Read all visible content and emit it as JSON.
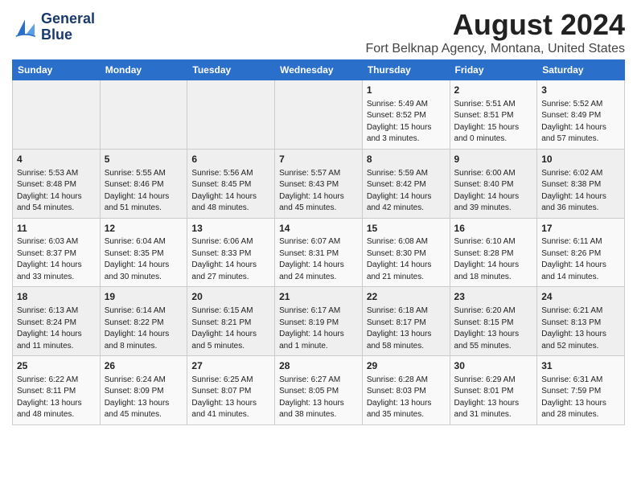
{
  "header": {
    "logo_line1": "General",
    "logo_line2": "Blue",
    "main_title": "August 2024",
    "subtitle": "Fort Belknap Agency, Montana, United States"
  },
  "weekdays": [
    "Sunday",
    "Monday",
    "Tuesday",
    "Wednesday",
    "Thursday",
    "Friday",
    "Saturday"
  ],
  "weeks": [
    [
      {
        "day": "",
        "info": ""
      },
      {
        "day": "",
        "info": ""
      },
      {
        "day": "",
        "info": ""
      },
      {
        "day": "",
        "info": ""
      },
      {
        "day": "1",
        "info": "Sunrise: 5:49 AM\nSunset: 8:52 PM\nDaylight: 15 hours\nand 3 minutes."
      },
      {
        "day": "2",
        "info": "Sunrise: 5:51 AM\nSunset: 8:51 PM\nDaylight: 15 hours\nand 0 minutes."
      },
      {
        "day": "3",
        "info": "Sunrise: 5:52 AM\nSunset: 8:49 PM\nDaylight: 14 hours\nand 57 minutes."
      }
    ],
    [
      {
        "day": "4",
        "info": "Sunrise: 5:53 AM\nSunset: 8:48 PM\nDaylight: 14 hours\nand 54 minutes."
      },
      {
        "day": "5",
        "info": "Sunrise: 5:55 AM\nSunset: 8:46 PM\nDaylight: 14 hours\nand 51 minutes."
      },
      {
        "day": "6",
        "info": "Sunrise: 5:56 AM\nSunset: 8:45 PM\nDaylight: 14 hours\nand 48 minutes."
      },
      {
        "day": "7",
        "info": "Sunrise: 5:57 AM\nSunset: 8:43 PM\nDaylight: 14 hours\nand 45 minutes."
      },
      {
        "day": "8",
        "info": "Sunrise: 5:59 AM\nSunset: 8:42 PM\nDaylight: 14 hours\nand 42 minutes."
      },
      {
        "day": "9",
        "info": "Sunrise: 6:00 AM\nSunset: 8:40 PM\nDaylight: 14 hours\nand 39 minutes."
      },
      {
        "day": "10",
        "info": "Sunrise: 6:02 AM\nSunset: 8:38 PM\nDaylight: 14 hours\nand 36 minutes."
      }
    ],
    [
      {
        "day": "11",
        "info": "Sunrise: 6:03 AM\nSunset: 8:37 PM\nDaylight: 14 hours\nand 33 minutes."
      },
      {
        "day": "12",
        "info": "Sunrise: 6:04 AM\nSunset: 8:35 PM\nDaylight: 14 hours\nand 30 minutes."
      },
      {
        "day": "13",
        "info": "Sunrise: 6:06 AM\nSunset: 8:33 PM\nDaylight: 14 hours\nand 27 minutes."
      },
      {
        "day": "14",
        "info": "Sunrise: 6:07 AM\nSunset: 8:31 PM\nDaylight: 14 hours\nand 24 minutes."
      },
      {
        "day": "15",
        "info": "Sunrise: 6:08 AM\nSunset: 8:30 PM\nDaylight: 14 hours\nand 21 minutes."
      },
      {
        "day": "16",
        "info": "Sunrise: 6:10 AM\nSunset: 8:28 PM\nDaylight: 14 hours\nand 18 minutes."
      },
      {
        "day": "17",
        "info": "Sunrise: 6:11 AM\nSunset: 8:26 PM\nDaylight: 14 hours\nand 14 minutes."
      }
    ],
    [
      {
        "day": "18",
        "info": "Sunrise: 6:13 AM\nSunset: 8:24 PM\nDaylight: 14 hours\nand 11 minutes."
      },
      {
        "day": "19",
        "info": "Sunrise: 6:14 AM\nSunset: 8:22 PM\nDaylight: 14 hours\nand 8 minutes."
      },
      {
        "day": "20",
        "info": "Sunrise: 6:15 AM\nSunset: 8:21 PM\nDaylight: 14 hours\nand 5 minutes."
      },
      {
        "day": "21",
        "info": "Sunrise: 6:17 AM\nSunset: 8:19 PM\nDaylight: 14 hours\nand 1 minute."
      },
      {
        "day": "22",
        "info": "Sunrise: 6:18 AM\nSunset: 8:17 PM\nDaylight: 13 hours\nand 58 minutes."
      },
      {
        "day": "23",
        "info": "Sunrise: 6:20 AM\nSunset: 8:15 PM\nDaylight: 13 hours\nand 55 minutes."
      },
      {
        "day": "24",
        "info": "Sunrise: 6:21 AM\nSunset: 8:13 PM\nDaylight: 13 hours\nand 52 minutes."
      }
    ],
    [
      {
        "day": "25",
        "info": "Sunrise: 6:22 AM\nSunset: 8:11 PM\nDaylight: 13 hours\nand 48 minutes."
      },
      {
        "day": "26",
        "info": "Sunrise: 6:24 AM\nSunset: 8:09 PM\nDaylight: 13 hours\nand 45 minutes."
      },
      {
        "day": "27",
        "info": "Sunrise: 6:25 AM\nSunset: 8:07 PM\nDaylight: 13 hours\nand 41 minutes."
      },
      {
        "day": "28",
        "info": "Sunrise: 6:27 AM\nSunset: 8:05 PM\nDaylight: 13 hours\nand 38 minutes."
      },
      {
        "day": "29",
        "info": "Sunrise: 6:28 AM\nSunset: 8:03 PM\nDaylight: 13 hours\nand 35 minutes."
      },
      {
        "day": "30",
        "info": "Sunrise: 6:29 AM\nSunset: 8:01 PM\nDaylight: 13 hours\nand 31 minutes."
      },
      {
        "day": "31",
        "info": "Sunrise: 6:31 AM\nSunset: 7:59 PM\nDaylight: 13 hours\nand 28 minutes."
      }
    ]
  ]
}
